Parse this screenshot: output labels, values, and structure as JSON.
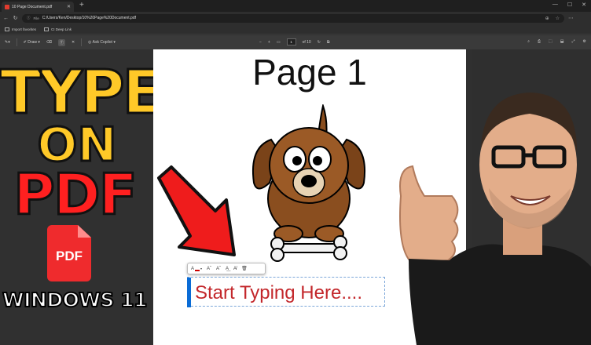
{
  "browser": {
    "tab_title": "10 Page Document.pdf",
    "address_label": "File",
    "address_path": "C:/Users/Ken/Desktop/10%20Page%20Document.pdf",
    "favorites": [
      "Import favorites",
      "CI Deep Link"
    ]
  },
  "pdf_toolbar": {
    "draw_label": "Draw",
    "copilot_label": "Ask Copilot",
    "page_current": "1",
    "page_total": "of 10"
  },
  "thumbnail": {
    "line1": "TYPE",
    "line2": "ON",
    "line3": "PDF",
    "icon_label": "PDF",
    "line4": "WINDOWS 11"
  },
  "page": {
    "title": "Page 1"
  },
  "text_box": {
    "text": "Start Typing Here...."
  },
  "colors": {
    "yellow": "#ffc928",
    "red": "#ff2020",
    "textbox_text": "#c3272b",
    "accent_blue": "#0a6cd6"
  }
}
